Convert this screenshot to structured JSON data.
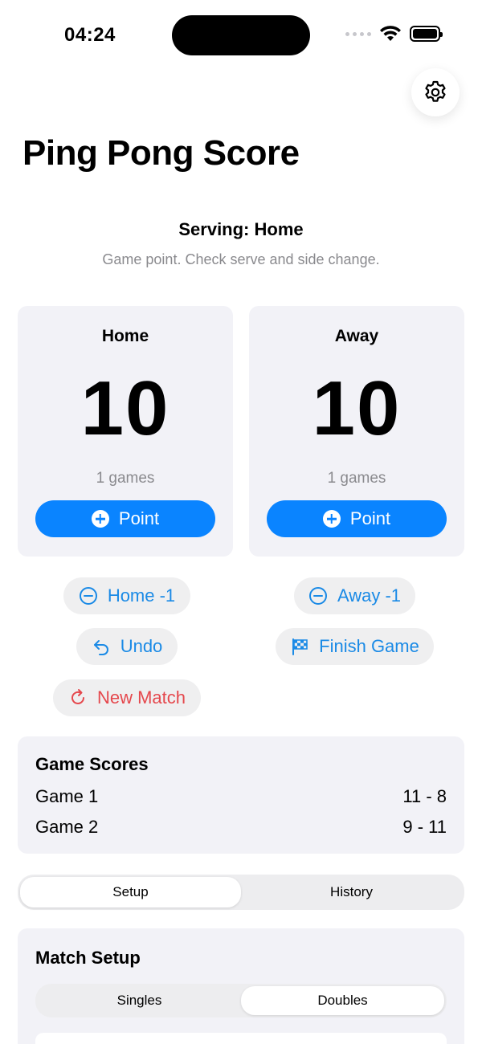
{
  "status_bar": {
    "time": "04:24"
  },
  "app": {
    "title": "Ping Pong Score"
  },
  "serving": {
    "label": "Serving: Home",
    "hint": "Game point. Check serve and side change."
  },
  "players": {
    "home": {
      "name": "Home",
      "score": "10",
      "games": "1 games",
      "point_label": "Point"
    },
    "away": {
      "name": "Away",
      "score": "10",
      "games": "1 games",
      "point_label": "Point"
    }
  },
  "actions": {
    "home_minus": "Home -1",
    "away_minus": "Away -1",
    "undo": "Undo",
    "finish_game": "Finish Game",
    "new_match": "New Match"
  },
  "game_scores": {
    "heading": "Game Scores",
    "rows": [
      {
        "label": "Game 1",
        "score": "11 - 8"
      },
      {
        "label": "Game 2",
        "score": "9 - 11"
      }
    ]
  },
  "tabs": {
    "items": [
      "Setup",
      "History"
    ],
    "selected": "Setup"
  },
  "match_setup": {
    "heading": "Match Setup",
    "modes": [
      "Singles",
      "Doubles"
    ],
    "selected_mode": "Doubles"
  },
  "colors": {
    "accent": "#0a84ff",
    "danger": "#e5484d",
    "card_bg": "#f2f2f7"
  },
  "icons": {
    "settings": "gear-icon",
    "point": "plus-circle-icon",
    "minus": "minus-circle-icon",
    "undo": "undo-arrow-icon",
    "finish": "checkered-flag-icon",
    "new_match": "restart-icon"
  }
}
